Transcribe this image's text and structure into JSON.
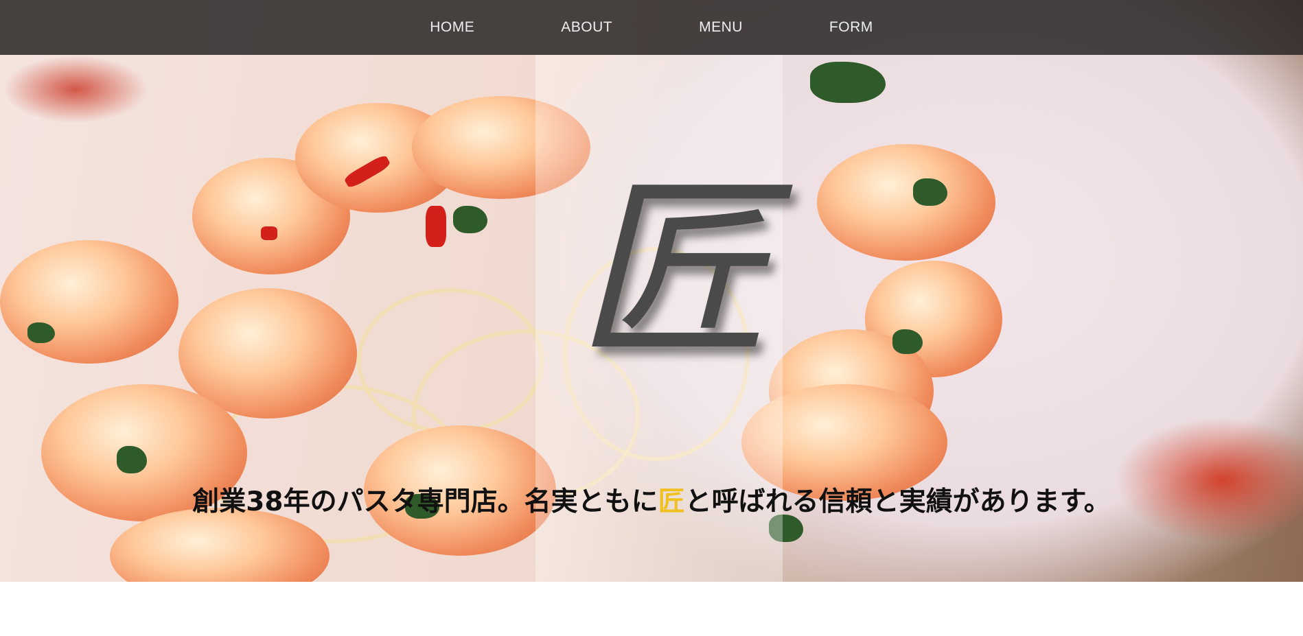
{
  "nav": {
    "items": [
      {
        "label": "HOME"
      },
      {
        "label": "ABOUT"
      },
      {
        "label": "MENU"
      },
      {
        "label": "FORM"
      }
    ]
  },
  "hero": {
    "logo_char": "匠",
    "tagline_before": "創業38年のパスタ専門店。名実ともに",
    "tagline_highlight": "匠",
    "tagline_after": "と呼ばれる信頼と実績があります。",
    "highlight_color": "#f0c020"
  },
  "colors": {
    "navbar_bg": "#282424",
    "nav_text": "#eeeeee",
    "tagline_text": "#111111"
  }
}
